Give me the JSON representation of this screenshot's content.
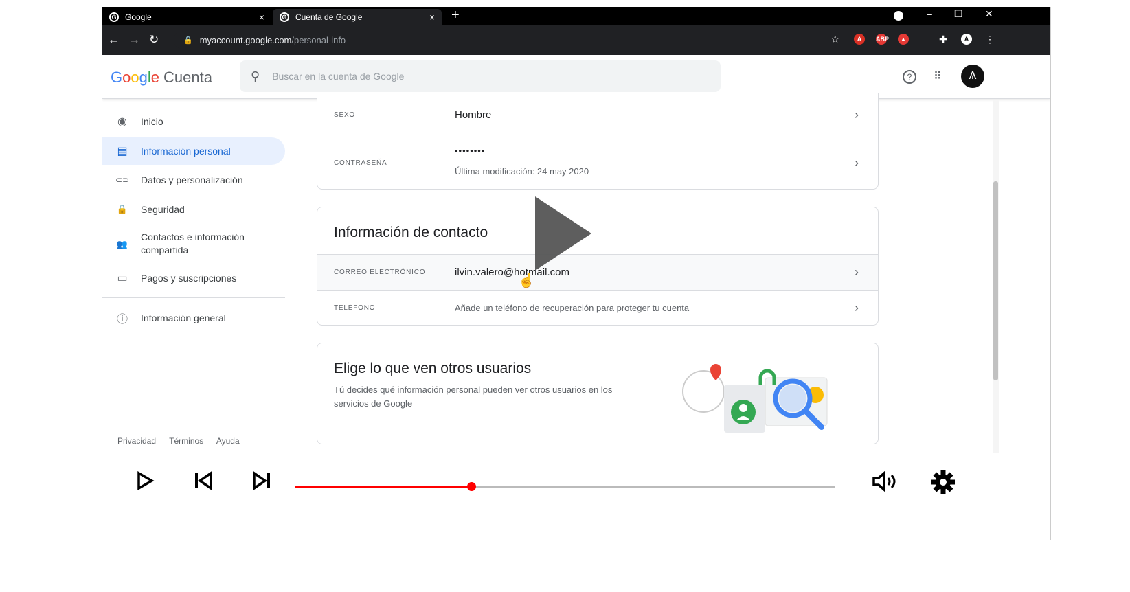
{
  "browser": {
    "tabs": [
      {
        "label": "Google",
        "close": "×"
      },
      {
        "label": "Cuenta de Google",
        "close": "×"
      }
    ],
    "new_tab": "+",
    "window_controls": {
      "minimize": "–",
      "restore": "❐",
      "close": "✕"
    },
    "url": {
      "domain": "myaccount.google.com",
      "path": "/personal-info"
    },
    "nav": {
      "back": "←",
      "forward": "→",
      "reload": "↻"
    }
  },
  "header": {
    "logo": {
      "g1": "G",
      "g2": "o",
      "g3": "o",
      "g4": "g",
      "g5": "l",
      "g6": "e",
      "product": "Cuenta"
    },
    "search_placeholder": "Buscar en la cuenta de Google",
    "icons": {
      "help": "?",
      "apps": "⋮⋮⋮",
      "avatar": "Ѧ"
    }
  },
  "sidebar": {
    "items": [
      {
        "label": "Inicio",
        "icon": "account-circle-icon",
        "glyph": "◉"
      },
      {
        "label": "Información personal",
        "icon": "id-card-icon",
        "glyph": "▤",
        "active": true
      },
      {
        "label": "Datos y personalización",
        "icon": "toggle-icon",
        "glyph": "⊂⊃"
      },
      {
        "label": "Seguridad",
        "icon": "lock-icon",
        "glyph": "🔒"
      },
      {
        "label": "Contactos e información compartida",
        "line1": "Contactos e información",
        "line2": "compartida",
        "icon": "people-icon",
        "glyph": "👥"
      },
      {
        "label": "Pagos y suscripciones",
        "icon": "credit-card-icon",
        "glyph": "▭"
      },
      {
        "label": "Información general",
        "icon": "info-icon",
        "glyph": "ⓘ"
      }
    ],
    "footer": {
      "privacy": "Privacidad",
      "terms": "Términos",
      "help": "Ayuda"
    }
  },
  "basic_info": {
    "gender": {
      "label": "SEXO",
      "value": "Hombre"
    },
    "password": {
      "label": "CONTRASEÑA",
      "value": "••••••••",
      "sub": "Última modificación: 24 may 2020"
    }
  },
  "contact": {
    "title": "Información de contacto",
    "email": {
      "label": "CORREO ELECTRÓNICO",
      "value": "ilvin.valero@hotmail.com"
    },
    "phone": {
      "label": "TELÉFONO",
      "value": "Añade un teléfono de recuperación para proteger tu cuenta"
    }
  },
  "visibility": {
    "title": "Elige lo que ven otros usuarios",
    "desc_line1": "Tú decides qué información personal pueden ver otros usuarios en los",
    "desc_line2": "servicios de Google"
  },
  "player": {
    "progress": 0.327,
    "accent": "#ff0000"
  },
  "colors": {
    "active_bg": "#e8f0fe",
    "active_fg": "#1967d2"
  }
}
